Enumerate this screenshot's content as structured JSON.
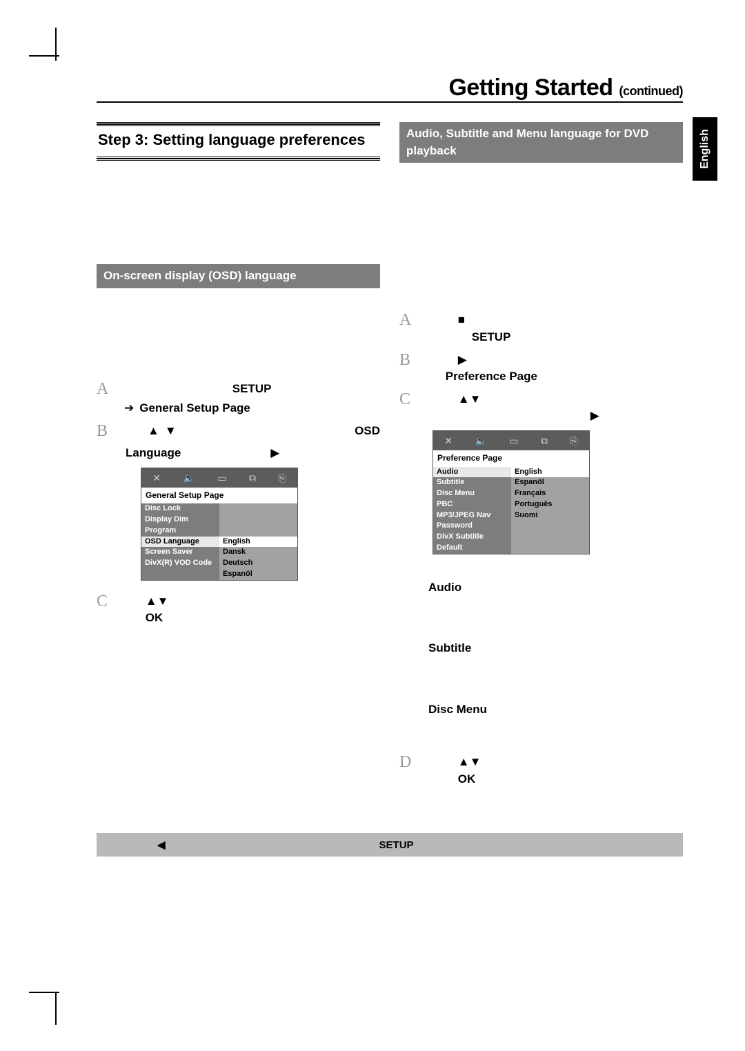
{
  "heading": {
    "main": "Getting Started",
    "suffix": "(continued)"
  },
  "lang_tab": "English",
  "left": {
    "step_title": "Step 3:  Setting language preferences",
    "subhead": "On-screen display (OSD) language",
    "A": {
      "setup": "SETUP"
    },
    "A_sub": "General Setup Page",
    "B": {
      "osd": "OSD",
      "lang": "Language"
    },
    "C": {
      "ok": "OK"
    },
    "menu": {
      "title": "General Setup Page",
      "left_items": [
        "Disc Lock",
        "Display Dim",
        "Program",
        "OSD Language",
        "Screen Saver",
        "DivX(R) VOD Code"
      ],
      "left_sel": "OSD Language",
      "right_items": [
        "English",
        "Dansk",
        "Deutsch",
        "Espanöl"
      ],
      "right_sel": "English"
    }
  },
  "right": {
    "subhead": "Audio, Subtitle and Menu language for DVD playback",
    "A": {
      "setup": "SETUP"
    },
    "B": {
      "pref": "Preference Page"
    },
    "terms": {
      "audio": "Audio",
      "subtitle": "Subtitle",
      "disc_menu": "Disc Menu"
    },
    "D": {
      "ok": "OK"
    },
    "menu": {
      "title": "Preference Page",
      "left_items": [
        "Audio",
        "Subtitle",
        "Disc Menu",
        "PBC",
        "MP3/JPEG Nav",
        "Password",
        "DivX Subtitle",
        "Default"
      ],
      "left_sel": "Audio",
      "right_items": [
        "English",
        "Espanöl",
        "Français",
        "Português",
        "Suomi"
      ],
      "right_sel": "English"
    }
  },
  "footer": {
    "setup": "SETUP"
  },
  "letters": {
    "A": "A",
    "B": "B",
    "C": "C",
    "D": "D"
  },
  "glyph": {
    "stop": "■",
    "play": "▶",
    "left": "◀",
    "up": "▲",
    "down": "▼",
    "right_arrow": "➔"
  }
}
